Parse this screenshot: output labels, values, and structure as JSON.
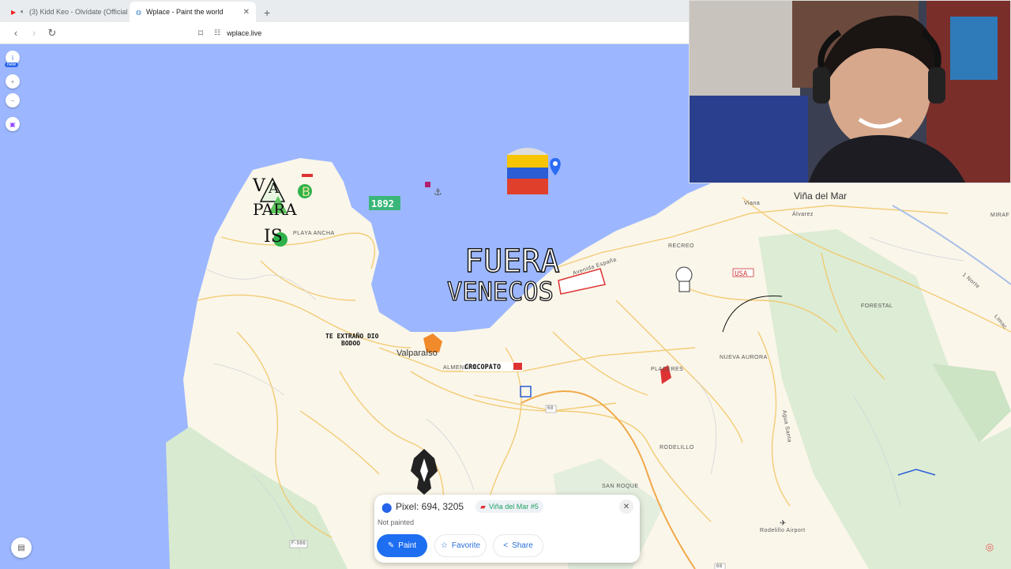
{
  "browser": {
    "tabs": [
      {
        "title": "(3) Kidd Keo - Olvídate (Official V",
        "icon": "youtube-icon"
      },
      {
        "title": "Wplace - Paint the world",
        "icon": "globe-icon",
        "active": true
      }
    ],
    "url": "wplace.live"
  },
  "map": {
    "labels": {
      "vina_del_mar": "Viña del Mar",
      "valparaiso": "Valparaíso",
      "playa_ancha": "PLAYA ANCHA",
      "recreo": "RECREO",
      "forestal": "FORESTAL",
      "nueva_aurora": "NUEVA AURORA",
      "placeres": "PLACERES",
      "rodelillo": "RODELILLO",
      "san_roque": "SAN ROQUE",
      "almendral": "ALMENDRAL",
      "rodelillo_airport": "Rodelillo Airport",
      "avenida_espana": "Avenida España",
      "miraflores": "MIRAF",
      "route_68_a": "68",
      "route_68_b": "68",
      "route_f986": "F-986",
      "agua_santa": "Agua Santa",
      "alvarez": "Álvarez",
      "vianna": "Viana",
      "limache": "Limac",
      "norte": "1 Norte"
    },
    "art": {
      "fuera": "FUERA",
      "venecos": "VENECOS",
      "year": "1892",
      "te_extrano_1": "TE EXTRAÑO DIO",
      "te_extrano_2": "BODOO",
      "crocopato": "CROCOPATO",
      "valparaiso_art": "VAL PARA ISO",
      "usa": "USA"
    }
  },
  "pixel_card": {
    "pixel_label": "Pixel: 694, 3205",
    "region": "Viña del Mar #5",
    "status": "Not painted",
    "paint": "Paint",
    "favorite": "Favorite",
    "share": "Share"
  },
  "left_controls": {
    "info": "i",
    "new_badge": "new"
  }
}
